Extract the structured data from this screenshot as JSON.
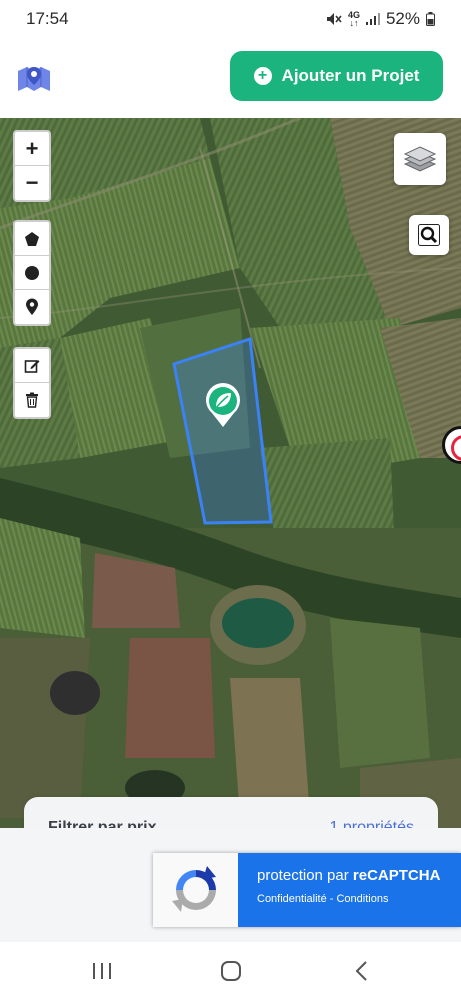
{
  "status_bar": {
    "time": "17:54",
    "network_top": "4G",
    "battery": "52%"
  },
  "header": {
    "logo_icon": "map-pin-logo-icon",
    "add_project_label": "Ajouter un Projet"
  },
  "map": {
    "controls": {
      "zoom_in": "+",
      "zoom_out": "−"
    },
    "marker_icon": "leaf-pin-icon"
  },
  "filter_card": {
    "title": "Filtrer par prix",
    "count": "1 propriétés"
  },
  "recaptcha": {
    "line1_prefix": "protection par ",
    "line1_brand": "reCAPTCHA",
    "line2": "Confidentialité - Conditions"
  },
  "colors": {
    "brand_green": "#1bb47e",
    "polygon_blue": "#3b82f6",
    "recaptcha_blue": "#1a73e8"
  }
}
